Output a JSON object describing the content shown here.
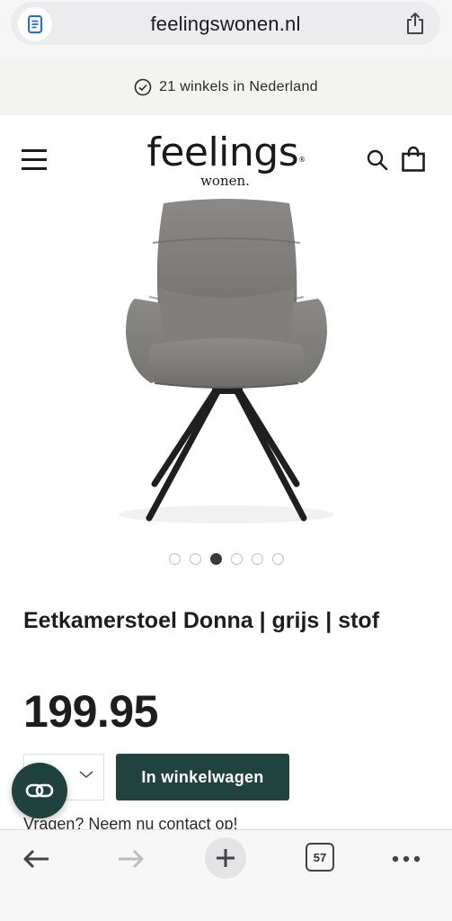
{
  "browser": {
    "url": "feelingswonen.nl",
    "tabs_count": "57"
  },
  "announcement": {
    "text": "21 winkels in Nederland"
  },
  "header": {
    "logo_main": "feelings",
    "logo_sub": "wonen.",
    "logo_reg": "®"
  },
  "gallery": {
    "image_count": 6,
    "active_index": 2
  },
  "product": {
    "title": "Eetkamerstoel Donna | grijs | stof",
    "price": "199.95",
    "add_to_cart_label": "In winkelwagen",
    "contact_text": "Vragen? Neem nu contact op!"
  },
  "colors": {
    "brand_green": "#21433f",
    "announcement_bg": "#f3f3f1"
  },
  "icons": [
    "reader-icon",
    "share-icon",
    "check-circle-icon",
    "menu-icon",
    "search-icon",
    "bag-icon",
    "chevron-down-icon",
    "chat-icon",
    "back-arrow-icon",
    "forward-arrow-icon",
    "plus-icon",
    "tabs-icon",
    "more-icon"
  ]
}
